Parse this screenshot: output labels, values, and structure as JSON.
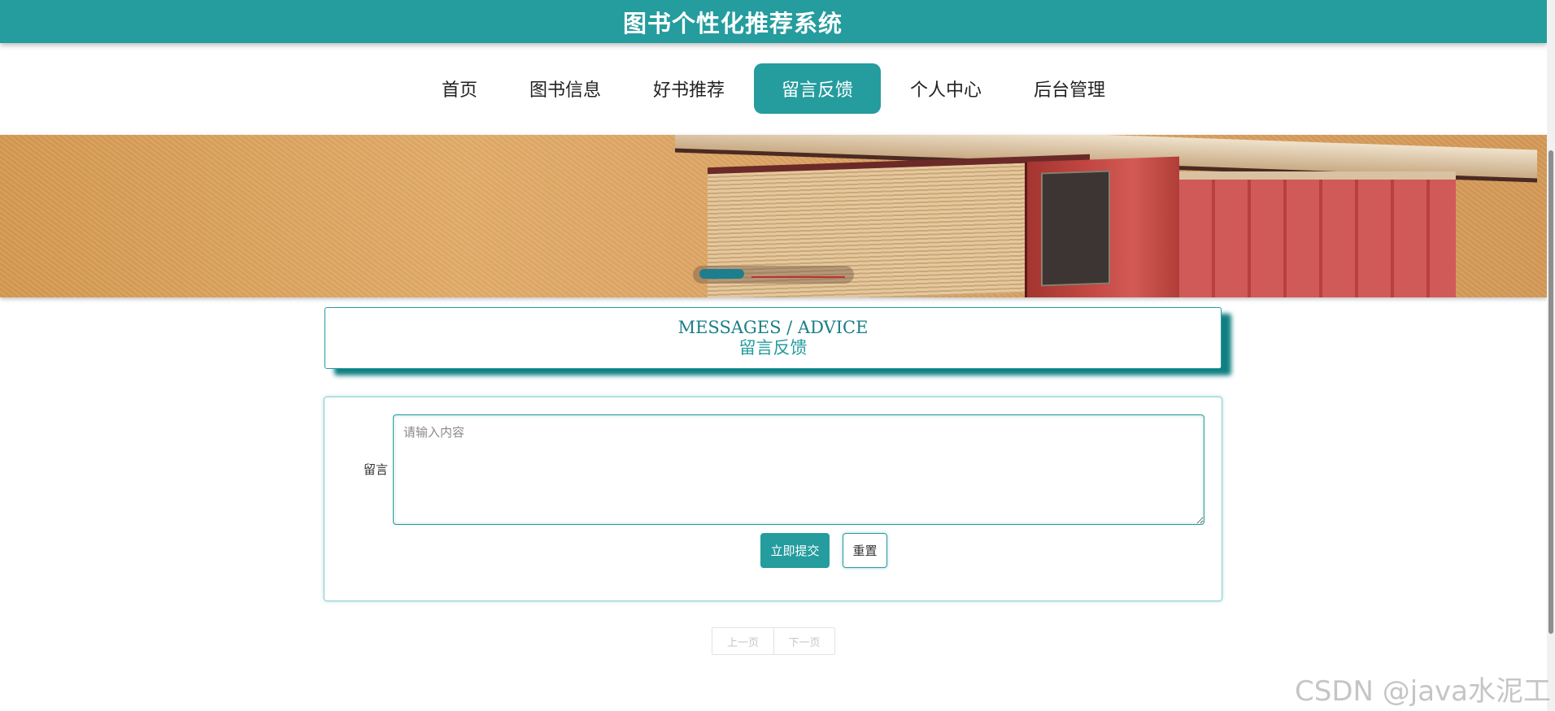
{
  "header": {
    "site_title": "图书个性化推荐系统"
  },
  "nav": {
    "items": [
      {
        "label": "首页"
      },
      {
        "label": "图书信息"
      },
      {
        "label": "好书推荐"
      },
      {
        "label": "留言反馈",
        "active": true
      },
      {
        "label": "个人中心"
      },
      {
        "label": "后台管理"
      }
    ]
  },
  "banner": {
    "carousel_active_index": 0
  },
  "section": {
    "title_en": "MESSAGES / ADVICE",
    "title_cn": "留言反馈"
  },
  "form": {
    "message_label": "留言",
    "message_value": "",
    "message_placeholder": "请输入内容",
    "submit_label": "立即提交",
    "reset_label": "重置"
  },
  "pager": {
    "prev_label": "上一页",
    "next_label": "下一页"
  },
  "watermark": "CSDN @java水泥工",
  "colors": {
    "accent": "#259c9e",
    "accent_dark": "#0f7f82"
  }
}
